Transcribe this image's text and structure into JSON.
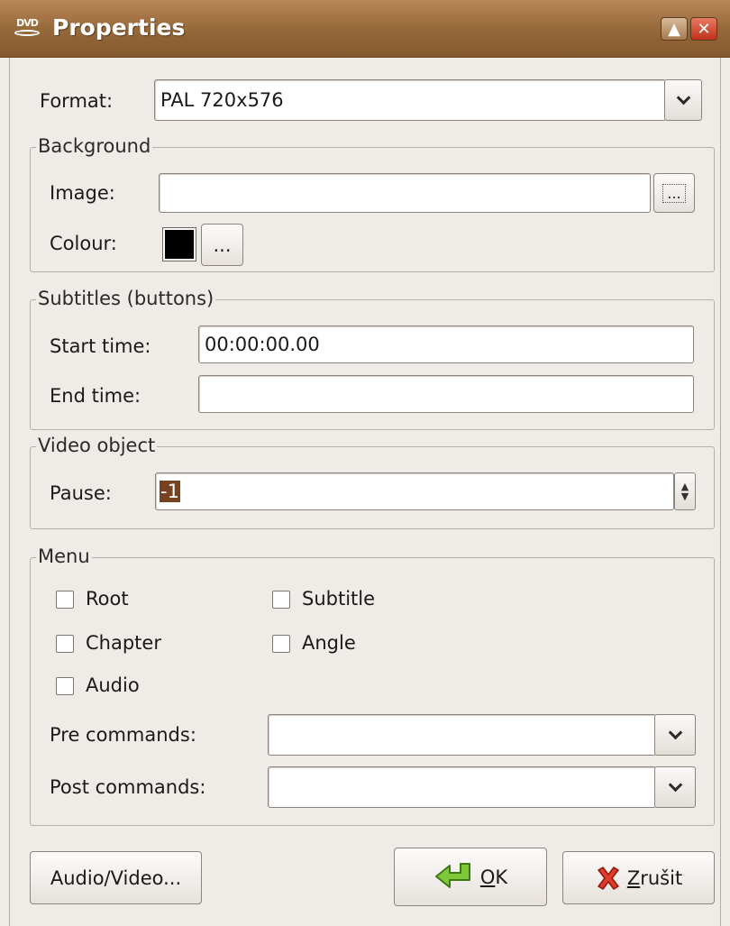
{
  "window": {
    "title": "Properties",
    "icon_name": "dvd-icon",
    "icon_text": "DVD"
  },
  "format": {
    "label": "Format:",
    "value": "PAL 720x576"
  },
  "background": {
    "title": "Background",
    "image_label": "Image:",
    "image_value": "",
    "browse_label": "...",
    "colour_label": "Colour:",
    "colour_value": "#000000",
    "colour_button_label": "..."
  },
  "subtitles": {
    "title": "Subtitles (buttons)",
    "start_label": "Start time:",
    "start_value": "00:00:00.00",
    "end_label": "End time:",
    "end_value": ""
  },
  "video_object": {
    "title": "Video object",
    "pause_label": "Pause:",
    "pause_value": "-1"
  },
  "menu": {
    "title": "Menu",
    "checkboxes": [
      {
        "label": "Root",
        "checked": false
      },
      {
        "label": "Subtitle",
        "checked": false
      },
      {
        "label": "Chapter",
        "checked": false
      },
      {
        "label": "Angle",
        "checked": false
      },
      {
        "label": "Audio",
        "checked": false
      }
    ],
    "pre_label": "Pre commands:",
    "pre_value": "",
    "post_label": "Post commands:",
    "post_value": ""
  },
  "buttons": {
    "audio_video": "Audio/Video...",
    "ok": "OK",
    "cancel": "Zrušit"
  },
  "colors": {
    "titlebar": "#946739",
    "selection": "#76421f",
    "window_bg": "#efebe7"
  }
}
